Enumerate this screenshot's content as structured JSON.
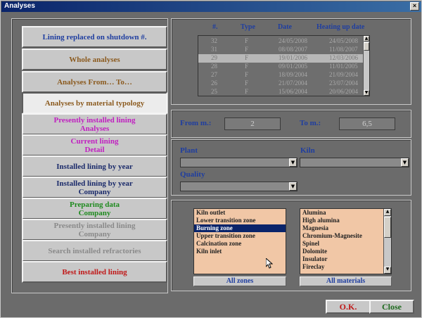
{
  "window": {
    "title": "Analyses"
  },
  "menu": [
    {
      "label": "Lining replaced on shutdown #.",
      "color": "#1f3ea0"
    },
    {
      "label": "Whole analyses",
      "color": "#8b5a1e"
    },
    {
      "label": "Analyses From… To…",
      "color": "#8b5a1e"
    },
    {
      "label": "Analyses by material typology",
      "color": "#8b5a1e"
    },
    {
      "line1": "Presently installed lining",
      "line2": "Analyses",
      "color": "#c020c0"
    },
    {
      "line1": "Current lining",
      "line2": "Detail",
      "color": "#c020c0"
    },
    {
      "label": "Installed lining by year",
      "color": "#1a2a6a"
    },
    {
      "line1": "Installed lining by year",
      "line2": "Company",
      "color": "#1a2a6a"
    },
    {
      "line1": "Preparing data",
      "line2": "Company",
      "color": "#1e8a1e"
    },
    {
      "line1": "Presently installed lining",
      "line2": "Company",
      "color": "#8a8a8a"
    },
    {
      "label": "Search installed refractories",
      "color": "#8a8a8a"
    },
    {
      "label": "Best installed lining",
      "color": "#c01818"
    }
  ],
  "table": {
    "columns": [
      "#.",
      "Type",
      "Date",
      "Heating up date"
    ],
    "rows": [
      [
        "32",
        "F",
        "24/05/2008",
        "24/05/2008"
      ],
      [
        "31",
        "F",
        "08/08/2007",
        "11/08/2007"
      ],
      [
        "29",
        "F",
        "19/01/2006",
        "12/03/2006"
      ],
      [
        "28",
        "F",
        "09/01/2005",
        "11/01/2005"
      ],
      [
        "27",
        "F",
        "18/09/2004",
        "21/09/2004"
      ],
      [
        "26",
        "F",
        "21/07/2004",
        "23/07/2004"
      ],
      [
        "25",
        "F",
        "15/06/2004",
        "20/06/2004"
      ]
    ]
  },
  "range": {
    "from_label": "From m.:",
    "from_value": "2",
    "to_label": "To m.:",
    "to_value": "6,5"
  },
  "filters": {
    "plant_label": "Plant",
    "kiln_label": "Kiln",
    "quality_label": "Quality",
    "plant_value": "",
    "kiln_value": "",
    "quality_value": ""
  },
  "zones": [
    "Kiln outlet",
    "Lower transition zone",
    "Burning zone",
    "Upper transition zone",
    "Calcination zone",
    "Kiln inlet"
  ],
  "materials": [
    "Alumina",
    "High alumina",
    "Magnesia",
    "Chromium-Magnesite",
    "Spinel",
    "Dolomite",
    "Insulator",
    "Fireclay"
  ],
  "buttons": {
    "all_zones": "All zones",
    "all_materials": "All materials",
    "ok": "O.K.",
    "close": "Close"
  },
  "icons": {
    "close": "close-icon",
    "arrow_down": "chevron-down-icon",
    "arrow_up": "chevron-up-icon",
    "cursor": "mouse-pointer-icon"
  },
  "colors": {
    "ok_text": "#c01818",
    "close_text": "#1e6a1e",
    "heading_blue": "#1f3ea0",
    "list_bg": "#f1c7a6",
    "selection": "#0a246a"
  }
}
